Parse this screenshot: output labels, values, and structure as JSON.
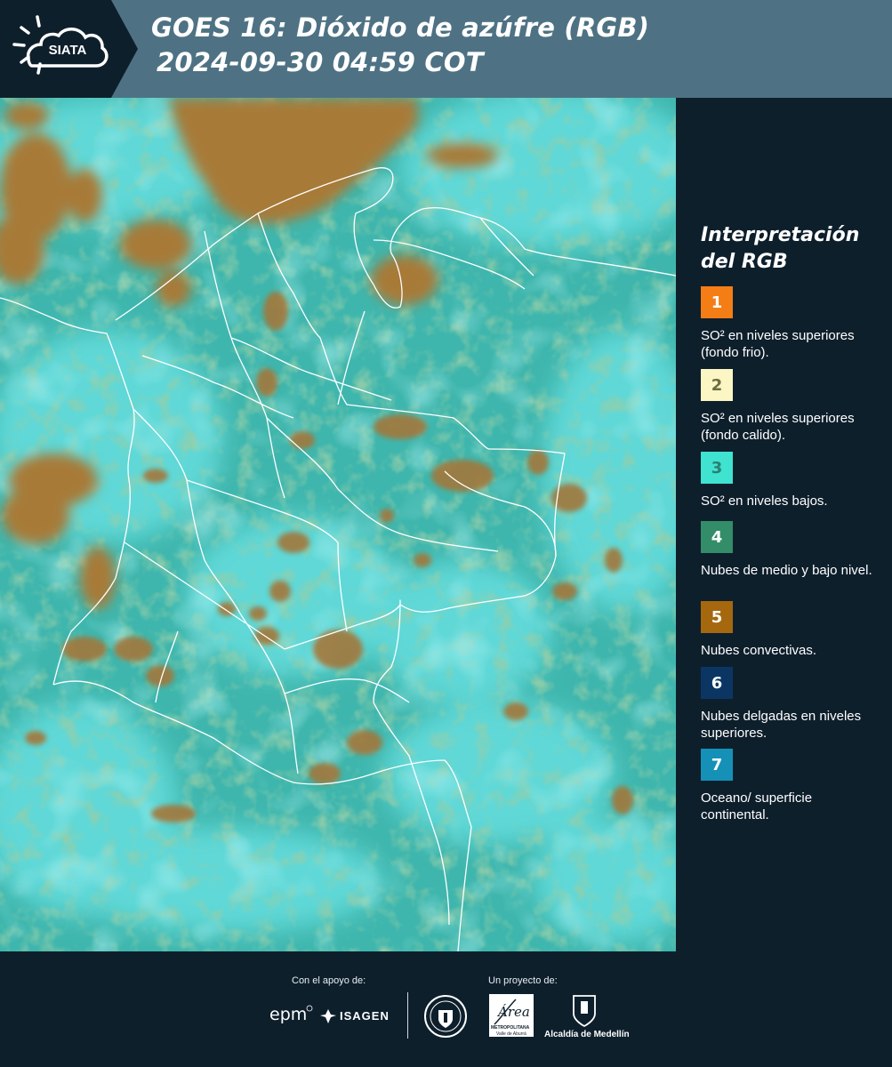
{
  "header": {
    "logo_text": "SIATA",
    "title_line1": "GOES 16: Dióxido de azúfre (RGB)",
    "title_line2": "2024-09-30 04:59 COT"
  },
  "map": {
    "image_kind": "satellite-rgb-composite",
    "colors": {
      "ocean_surface": "#3fb6ad",
      "cyan_cloud": "#5fe0e0",
      "convective": "#a77a38",
      "mid_low_cloud": "#4e9a6a",
      "borders": "#ffffff"
    }
  },
  "legend": {
    "title": "Interpretación del RGB",
    "items": [
      {
        "number": "1",
        "color": "#f47d16",
        "number_color": "#ffffff",
        "text": "SO² en niveles superiores (fondo frio)."
      },
      {
        "number": "2",
        "color": "#fbf6c3",
        "number_color": "#6b6b3e",
        "text": "SO² en niveles superiores (fondo calido)."
      },
      {
        "number": "3",
        "color": "#3fe3cf",
        "number_color": "#2a7f73",
        "text": "SO² en niveles bajos."
      },
      {
        "number": "4",
        "color": "#338d68",
        "number_color": "#ffffff",
        "text": "Nubes de medio y bajo nivel."
      },
      {
        "number": "5",
        "color": "#a5680f",
        "number_color": "#ffffff",
        "text": "Nubes convectivas."
      },
      {
        "number": "6",
        "color": "#0b3664",
        "number_color": "#ffffff",
        "text": "Nubes delgadas en niveles superiores."
      },
      {
        "number": "7",
        "color": "#1591b8",
        "number_color": "#ffffff",
        "text": "Oceano/ superficie continental."
      }
    ]
  },
  "footer": {
    "support_label": "Con el apoyo de:",
    "project_label": "Un proyecto de:",
    "sponsor_epm": "epm",
    "sponsor_isagen": "ISAGEN",
    "area_script": "Área",
    "area_line1": "METROPOLITANA",
    "area_line2": "Valle de Aburrá",
    "alcaldia": "Alcaldía de Medellín"
  }
}
